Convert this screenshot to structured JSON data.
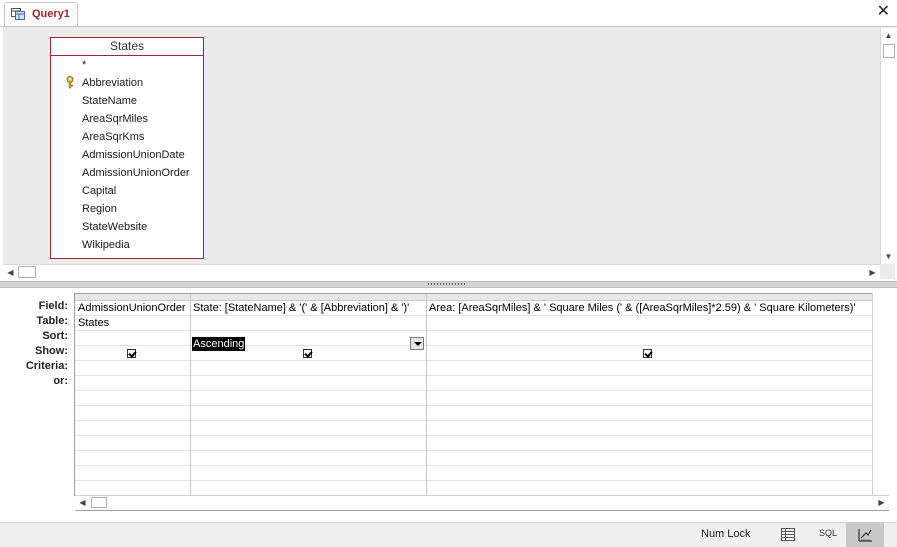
{
  "tab": {
    "label": "Query1",
    "close_glyph": "✕",
    "icon": "query-design-icon"
  },
  "table_box": {
    "title": "States",
    "fields": [
      "*",
      "Abbreviation",
      "StateName",
      "AreaSqrMiles",
      "AreaSqrKms",
      "AdmissionUnionDate",
      "AdmissionUnionOrder",
      "Capital",
      "Region",
      "StateWebsite",
      "Wikipedia"
    ],
    "key_icon": "primary-key-icon",
    "border_color": "#a4262c"
  },
  "grid": {
    "row_labels": [
      "Field:",
      "Table:",
      "Sort:",
      "Show:",
      "Criteria:",
      "or:"
    ],
    "columns": [
      {
        "field": "AdmissionUnionOrder",
        "table": "States",
        "sort": "",
        "show": true
      },
      {
        "field": "State: [StateName] & '(' & [Abbreviation] & ')'",
        "table": "",
        "sort": "Ascending",
        "show": true
      },
      {
        "field": "Area: [AreaSqrMiles] & ' Square Miles (' & ([AreaSqrMiles]*2.59) & ' Square Kilometers)'",
        "table": "",
        "sort": "",
        "show": true
      }
    ]
  },
  "statusbar": {
    "numlock": "Num Lock",
    "sql": "SQL",
    "datasheet_icon": "datasheet-view-icon",
    "design_icon": "design-view-icon"
  }
}
